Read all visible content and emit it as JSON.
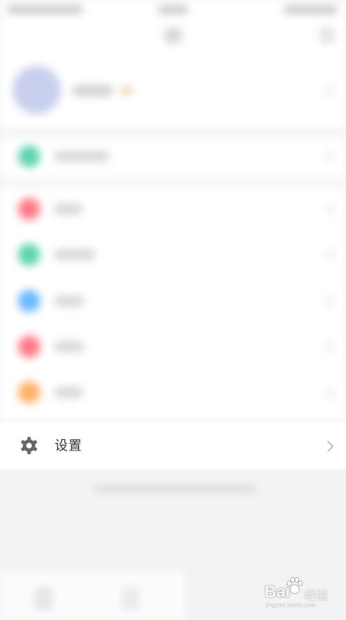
{
  "settings_row": {
    "label": "设置",
    "icon": "gear-icon",
    "chevron_icon": "chevron-right-icon"
  },
  "menu_rows": [
    {
      "icon_color": "#5fd3b0"
    },
    {
      "icon_color": "#ff7a86"
    },
    {
      "icon_color": "#5fd3b0"
    },
    {
      "icon_color": "#6ab8ff"
    },
    {
      "icon_color": "#ff7a86"
    },
    {
      "icon_color": "#ffb066"
    }
  ],
  "colors": {
    "avatar": "#c9d0ee",
    "settings_text": "#333333",
    "icon_gray": "#666666",
    "chevron": "#b5b5b5",
    "background": "#f2f3f5"
  },
  "watermark": {
    "brand": "Bai",
    "brand_cn": "经验",
    "url": "jingyan.baidu.com",
    "icon": "baidu-paw-icon"
  }
}
